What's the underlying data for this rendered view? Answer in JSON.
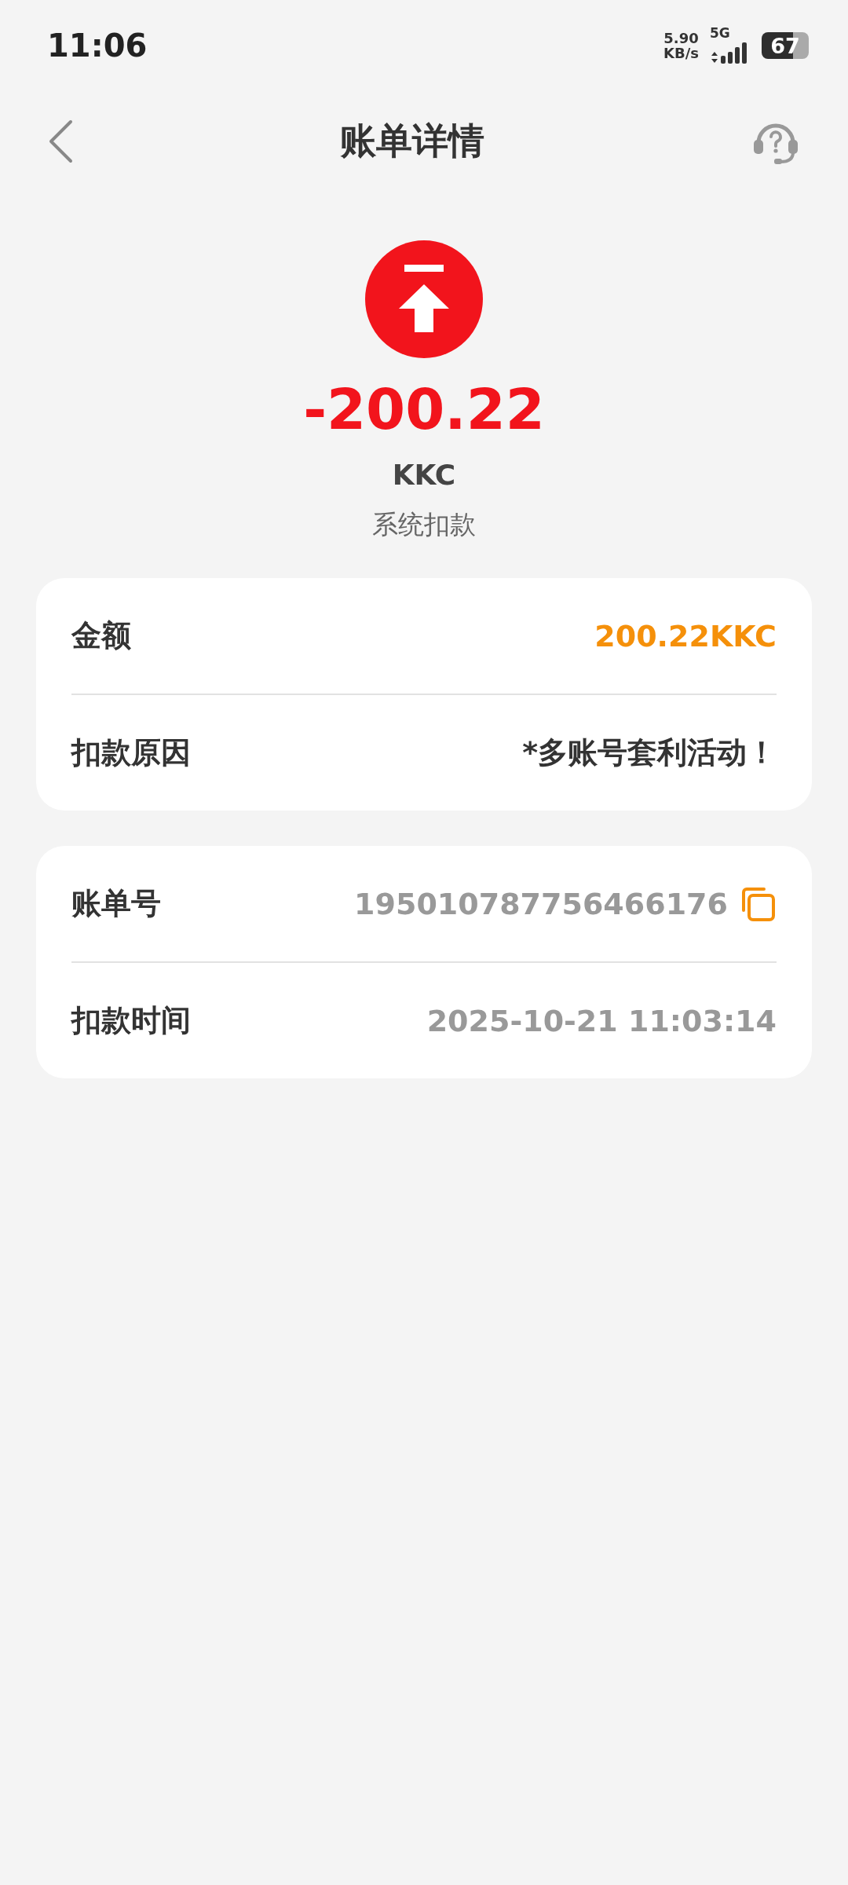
{
  "status_bar": {
    "time": "11:06",
    "net_speed": "5.90",
    "net_unit": "KB/s",
    "network": "5G",
    "battery": "67"
  },
  "header": {
    "title": "账单详情"
  },
  "summary": {
    "amount": "-200.22",
    "currency": "KKC",
    "type": "系统扣款"
  },
  "cards": [
    {
      "rows": [
        {
          "label": "金额",
          "value": "200.22KKC",
          "kind": "amount"
        },
        {
          "label": "扣款原因",
          "value": "*多账号套利活动！",
          "kind": "text"
        }
      ]
    },
    {
      "rows": [
        {
          "label": "账单号",
          "value": "195010787756466176",
          "kind": "copyable"
        },
        {
          "label": "扣款时间",
          "value": "2025-10-21 11:03:14",
          "kind": "muted"
        }
      ]
    }
  ]
}
